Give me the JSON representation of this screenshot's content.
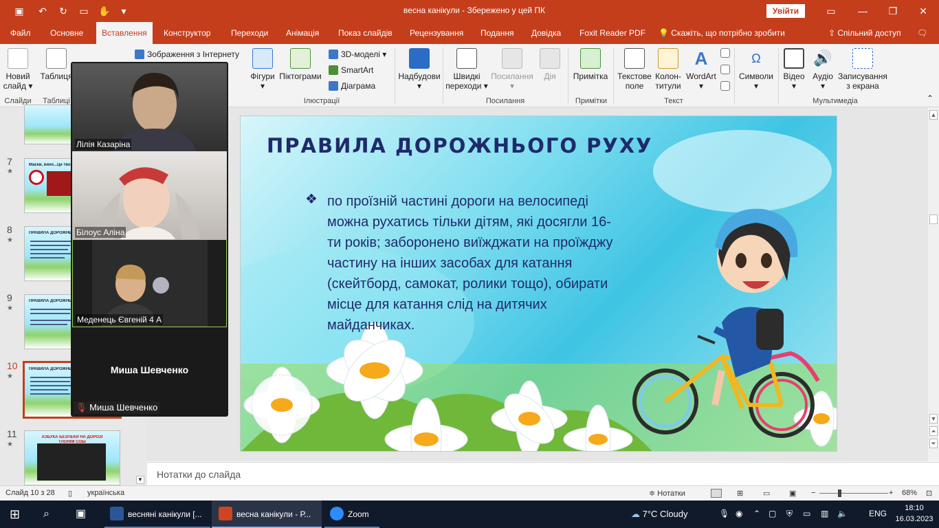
{
  "window": {
    "title": "весна канікули  -  Збережено у цей ПК",
    "signin_label": "Увійти"
  },
  "tabs": [
    {
      "label": "Файл"
    },
    {
      "label": "Основне"
    },
    {
      "label": "Вставлення"
    },
    {
      "label": "Конструктор"
    },
    {
      "label": "Переходи"
    },
    {
      "label": "Анімація"
    },
    {
      "label": "Показ слайдів"
    },
    {
      "label": "Рецензування"
    },
    {
      "label": "Подання"
    },
    {
      "label": "Довідка"
    },
    {
      "label": "Foxit Reader PDF"
    }
  ],
  "tell_me": "Скажіть, що потрібно зробити",
  "share_label": "Спільний доступ",
  "ribbon": {
    "new_slide": [
      "Новий",
      "слайд"
    ],
    "table": "Таблиця",
    "online_pictures": "Зображення з Інтернету",
    "shapes": "Фігури",
    "icons": "Піктограми",
    "models3d": "3D-моделі",
    "smartart": "SmartArt",
    "chart": "Діаграма",
    "addins": "Надбудови",
    "zoom": [
      "Швидкі",
      "переходи"
    ],
    "link": "Посилання",
    "action": "Дія",
    "comment": "Примітка",
    "textbox": [
      "Текстове",
      "поле"
    ],
    "header_footer": [
      "Колон-",
      "титули"
    ],
    "wordart": "WordArt",
    "symbols": "Символи",
    "video": "Відео",
    "audio": "Аудіо",
    "screen_recording": [
      "Записування",
      "з екрана"
    ],
    "groups": {
      "slides": "Слайди",
      "tables": "Таблиці",
      "illustrations": "Ілюстрації",
      "links": "Посилання",
      "comments": "Примітки",
      "text": "Текст",
      "media": "Мультимедіа"
    }
  },
  "thumbnails": [
    {
      "num": "7",
      "title": "Маски, вихо...Це твоя..."
    },
    {
      "num": "8",
      "title": "ПРАВИЛА ДОРОЖНЬОГО..."
    },
    {
      "num": "9",
      "title": "ПРАВИЛА ДОРОЖНЬОГО"
    },
    {
      "num": "10",
      "title": "ПРАВИЛА ДОРОЖНЬОГО"
    },
    {
      "num": "11",
      "title": "АЗБУКА БЕЗПЕКИ НА ДОРОЗІ",
      "subtitle": "ТЛОНІМ СОБІ"
    }
  ],
  "slide": {
    "title": "ПРАВИЛА ДОРОЖНЬОГО РУХУ",
    "bullet": "❖",
    "body": "по проїзній частині дороги на велосипеді можна рухатись тільки дітям, які досягли 16-ти років; заборонено виїжджати на проїжджу частину на інших засобах для катання (скейтборд, самокат, ролики тощо), обирати місце для катання слід на дитячих майданчиках."
  },
  "notes_placeholder": "Нотатки до слайда",
  "status": {
    "slide_info": "Слайд 10 з 28",
    "language": "українська",
    "notes_label": "Нотатки",
    "zoom_level": "68%"
  },
  "zoom_call": {
    "participants": [
      {
        "name": "Лілія Казаріна"
      },
      {
        "name": "Білоус Аліна"
      },
      {
        "name": "Меденець Євгеній 4 А"
      }
    ],
    "audio_only_name": "Миша Шевченко",
    "muted_label": "Миша Шевченко"
  },
  "taskbar": {
    "apps": [
      {
        "label": "весняні канікули [..."
      },
      {
        "label": "весна канікули - Р..."
      },
      {
        "label": "Zoom"
      }
    ],
    "weather": "7°C  Cloudy",
    "lang": "ENG",
    "time": "18:10",
    "date": "16.03.2023"
  },
  "colors": {
    "accent": "#c43e1c",
    "slide_text": "#1f2a6b"
  }
}
